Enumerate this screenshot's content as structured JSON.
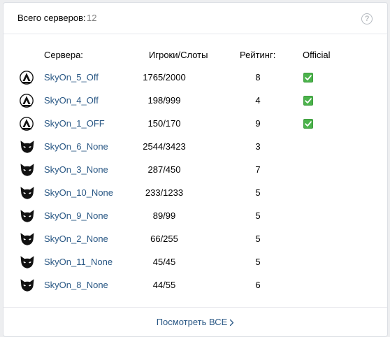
{
  "header": {
    "title": "Всего серверов:",
    "count": "12",
    "help_glyph": "?"
  },
  "columns": {
    "name": "Сервера:",
    "players": "Игроки/Слоты",
    "rating": "Рейтинг:",
    "official": "Official"
  },
  "servers": [
    {
      "name": "SkyOn_5_Off",
      "players": "1765/2000",
      "rating": "8",
      "official": true,
      "icon": "official-emblem-icon"
    },
    {
      "name": "SkyOn_4_Off",
      "players": "198/999",
      "rating": "4",
      "official": true,
      "icon": "official-emblem-icon"
    },
    {
      "name": "SkyOn_1_OFF",
      "players": "150/170",
      "rating": "9",
      "official": true,
      "icon": "official-emblem-icon"
    },
    {
      "name": "SkyOn_6_None",
      "players": "2544/3423",
      "rating": "3",
      "official": false,
      "icon": "cat-mask-icon"
    },
    {
      "name": "SkyOn_3_None",
      "players": "287/450",
      "rating": "7",
      "official": false,
      "icon": "cat-mask-icon"
    },
    {
      "name": "SkyOn_10_None",
      "players": "233/1233",
      "rating": "5",
      "official": false,
      "icon": "cat-mask-icon"
    },
    {
      "name": "SkyOn_9_None",
      "players": "89/99",
      "rating": "5",
      "official": false,
      "icon": "cat-mask-icon"
    },
    {
      "name": "SkyOn_2_None",
      "players": "66/255",
      "rating": "5",
      "official": false,
      "icon": "cat-mask-icon"
    },
    {
      "name": "SkyOn_11_None",
      "players": "45/45",
      "rating": "5",
      "official": false,
      "icon": "cat-mask-icon"
    },
    {
      "name": "SkyOn_8_None",
      "players": "44/55",
      "rating": "6",
      "official": false,
      "icon": "cat-mask-icon"
    }
  ],
  "footer": {
    "show_all": "Посмотреть ВСЕ"
  },
  "colors": {
    "link": "#2a5885",
    "check_green": "#4bb34b",
    "muted": "#828282"
  }
}
